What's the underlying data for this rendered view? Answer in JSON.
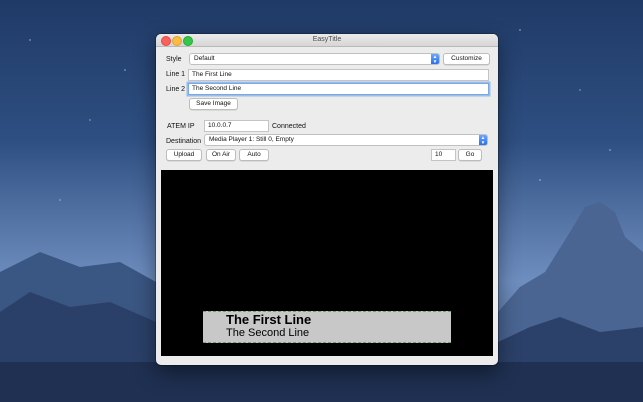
{
  "window": {
    "title": "EasyTitle"
  },
  "style": {
    "label": "Style",
    "value": "Default",
    "customize_label": "Customize"
  },
  "line1": {
    "label": "Line 1",
    "value": "The First Line"
  },
  "line2": {
    "label": "Line 2",
    "value": "The Second Line"
  },
  "save_image_label": "Save Image",
  "atem": {
    "label": "ATEM IP",
    "value": "10.0.0.7",
    "status": "Connected"
  },
  "destination": {
    "label": "Destination",
    "value": "Media Player 1: Still 0, Empty"
  },
  "actions": {
    "upload_label": "Upload",
    "on_air_label": "On Air",
    "auto_label": "Auto",
    "frames_value": "10",
    "go_label": "Go"
  },
  "preview": {
    "line1": "The First Line",
    "line2": "The Second Line"
  },
  "colors": {
    "accent": "#2c6ee6",
    "focus_ring": "#77a8e8",
    "preview_bg": "#000000",
    "lower_third_bg": "#c8c8c8"
  }
}
